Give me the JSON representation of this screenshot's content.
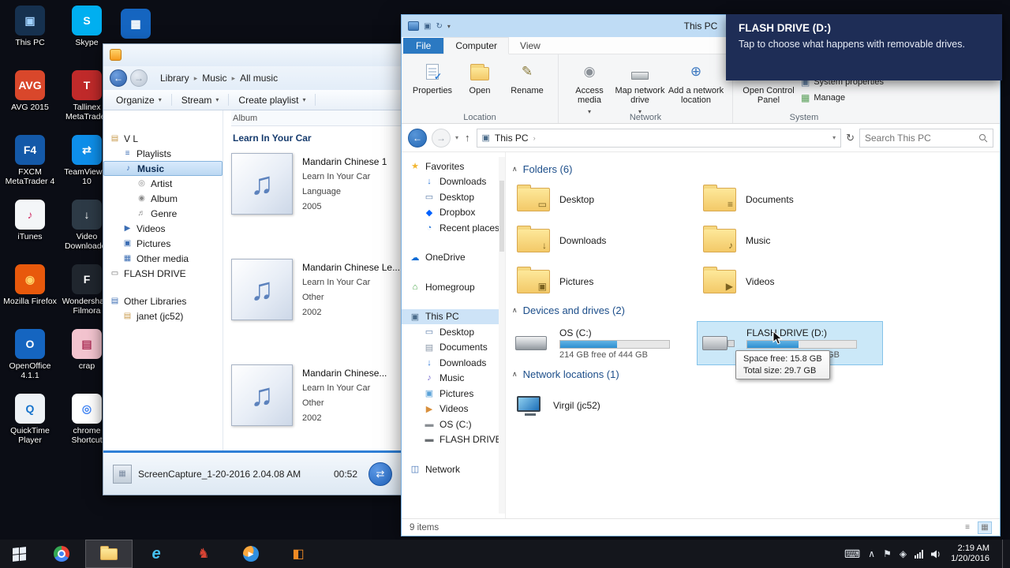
{
  "icons": {
    "back": "←",
    "forward": "→",
    "up": "↑",
    "dropdown": "▾",
    "refresh": "↻",
    "crumb_sep": "▸",
    "chevron": "›",
    "collapse": "∧",
    "album_note": "♫",
    "thumb": "▦",
    "shuffle": "⇄",
    "rename": "✎",
    "disc": "◉",
    "add_location": "⊕",
    "sysprops": "▣",
    "manage": "▦",
    "pc": "▣",
    "check": "✓",
    "keyboard": "⌨",
    "tray_chevron": "∧",
    "flag": "⚑",
    "diamond": "◈",
    "ie": "e",
    "knight": "♞",
    "appbox": "◧",
    "list_view": "≡",
    "thumb_view": "▦"
  },
  "desktop": {
    "icons": [
      {
        "label": "This PC",
        "glyph": "▣",
        "bg": "#16314f",
        "fg": "#9fd1ff"
      },
      {
        "label": "Skype",
        "glyph": "S",
        "bg": "#00aff0",
        "fg": "#ffffff"
      },
      {
        "label": "AVG 2015",
        "glyph": "AVG",
        "bg": "#d9472b",
        "fg": "#ffffff"
      },
      {
        "label": "Tallinex MetaTrader",
        "glyph": "T",
        "bg": "#c02a2a",
        "fg": "#ffffff"
      },
      {
        "label": "FXCM MetaTrader 4",
        "glyph": "F4",
        "bg": "#1459a8",
        "fg": "#ffffff"
      },
      {
        "label": "TeamViewer 10",
        "glyph": "⇄",
        "bg": "#0e8ee9",
        "fg": "#ffffff"
      },
      {
        "label": "iTunes",
        "glyph": "♪",
        "bg": "#f4f6f8",
        "fg": "#d3366b"
      },
      {
        "label": "Video Downloader",
        "glyph": "↓",
        "bg": "#2d3a46",
        "fg": "#ffffff"
      },
      {
        "label": "Mozilla Firefox",
        "glyph": "◉",
        "bg": "#e8590c",
        "fg": "#ffd166"
      },
      {
        "label": "Wondershare Filmora",
        "glyph": "F",
        "bg": "#20262e",
        "fg": "#ffffff"
      },
      {
        "label": "OpenOffice 4.1.1",
        "glyph": "O",
        "bg": "#1565c0",
        "fg": "#ffffff"
      },
      {
        "label": "crap",
        "glyph": "▤",
        "bg": "#f3c4cf",
        "fg": "#b0355c"
      },
      {
        "label": "QuickTime Player",
        "glyph": "Q",
        "bg": "#eef2f6",
        "fg": "#1673cc"
      },
      {
        "label": "chrome Shortcut",
        "glyph": "◎",
        "bg": "#ffffff",
        "fg": "#4285f4"
      }
    ],
    "floating_icon": {
      "glyph": "▦"
    }
  },
  "media_player": {
    "breadcrumb": {
      "items": [
        "Library",
        "Music",
        "All music"
      ]
    },
    "toolbar": {
      "items": [
        {
          "label": "Organize"
        },
        {
          "label": "Stream"
        },
        {
          "label": "Create playlist"
        }
      ]
    },
    "tree": {
      "items": [
        {
          "label": "V L",
          "glyph": "▤",
          "indent": 0,
          "color": "#c99b4e"
        },
        {
          "label": "Playlists",
          "glyph": "≡",
          "indent": 1,
          "color": "#3c6eb4"
        },
        {
          "label": "Music",
          "glyph": "♪",
          "indent": 1,
          "color": "#3c6eb4",
          "selected": true
        },
        {
          "label": "Artist",
          "glyph": "◎",
          "indent": 2,
          "color": "#8a8a8a"
        },
        {
          "label": "Album",
          "glyph": "◉",
          "indent": 2,
          "color": "#8a8a8a"
        },
        {
          "label": "Genre",
          "glyph": "♬",
          "indent": 2,
          "color": "#8a8a8a"
        },
        {
          "label": "Videos",
          "glyph": "▶",
          "indent": 1,
          "color": "#3c6eb4"
        },
        {
          "label": "Pictures",
          "glyph": "▣",
          "indent": 1,
          "color": "#3c6eb4"
        },
        {
          "label": "Other media",
          "glyph": "▦",
          "indent": 1,
          "color": "#3c6eb4"
        },
        {
          "label": "FLASH DRIVE",
          "glyph": "▭",
          "indent": 0,
          "color": "#6b6b6b"
        },
        {
          "label": "Other Libraries",
          "glyph": "▤",
          "indent": 0,
          "color": "#3c6eb4",
          "spacer": true
        },
        {
          "label": "janet (jc52)",
          "glyph": "▤",
          "indent": 1,
          "color": "#c99b4e"
        }
      ]
    },
    "list": {
      "column_header": "Album",
      "group_title": "Learn In Your Car",
      "items": [
        {
          "title": "Mandarin Chinese 1",
          "artist": "Learn In Your Car",
          "genre": "Language",
          "year": "2005"
        },
        {
          "title": "Mandarin Chinese Le...",
          "artist": "Learn In Your Car",
          "genre": "Other",
          "year": "2002"
        },
        {
          "title": "Mandarin Chinese...",
          "artist": "Learn In Your Car",
          "genre": "Other",
          "year": "2002"
        }
      ]
    },
    "playback": {
      "file": "ScreenCapture_1-20-2016 2.04.08 AM",
      "time": "00:52"
    }
  },
  "explorer": {
    "title": "This PC",
    "tabs": {
      "file": "File",
      "computer": "Computer",
      "view": "View"
    },
    "ribbon": {
      "properties": "Properties",
      "open": "Open",
      "rename": "Rename",
      "access_media": "Access media",
      "map_drive": "Map network drive",
      "add_location": "Add a network location",
      "control_panel": "Open Control Panel",
      "system_properties": "System properties",
      "manage": "Manage",
      "groups": {
        "location": "Location",
        "network": "Network",
        "system": "System"
      }
    },
    "address": {
      "path": "This PC",
      "search_placeholder": "Search This PC"
    },
    "nav": {
      "items": [
        {
          "label": "Favorites",
          "glyph": "★",
          "indent": 0,
          "color": "#f2b632"
        },
        {
          "label": "Downloads",
          "glyph": "↓",
          "indent": 1,
          "color": "#2f7bd9"
        },
        {
          "label": "Desktop",
          "glyph": "▭",
          "indent": 1,
          "color": "#5a7ca8"
        },
        {
          "label": "Dropbox",
          "glyph": "◆",
          "indent": 1,
          "color": "#0061fe"
        },
        {
          "label": "Recent places",
          "glyph": "◔",
          "indent": 1,
          "color": "#2f7bd9"
        },
        {
          "label": "OneDrive",
          "glyph": "☁",
          "indent": 0,
          "color": "#0a6cd6",
          "gap": true
        },
        {
          "label": "Homegroup",
          "glyph": "⌂",
          "indent": 0,
          "color": "#3fa13f",
          "gap": true
        },
        {
          "label": "This PC",
          "glyph": "▣",
          "indent": 0,
          "color": "#4a6b8a",
          "gap": true,
          "selected": true
        },
        {
          "label": "Desktop",
          "glyph": "▭",
          "indent": 1,
          "color": "#5a7ca8"
        },
        {
          "label": "Documents",
          "glyph": "▤",
          "indent": 1,
          "color": "#8a97a8"
        },
        {
          "label": "Downloads",
          "glyph": "↓",
          "indent": 1,
          "color": "#2f7bd9"
        },
        {
          "label": "Music",
          "glyph": "♪",
          "indent": 1,
          "color": "#7a6fd0"
        },
        {
          "label": "Pictures",
          "glyph": "▣",
          "indent": 1,
          "color": "#5aa2d8"
        },
        {
          "label": "Videos",
          "glyph": "▶",
          "indent": 1,
          "color": "#d88f3c"
        },
        {
          "label": "OS (C:)",
          "glyph": "▬",
          "indent": 1,
          "color": "#8a8f94"
        },
        {
          "label": "FLASH DRIVE (D",
          "glyph": "▬",
          "indent": 1,
          "color": "#6b6f73"
        },
        {
          "label": "Network",
          "glyph": "◫",
          "indent": 0,
          "color": "#3c6eb4",
          "gap": true
        }
      ]
    },
    "content": {
      "folders": {
        "header": "Folders (6)",
        "items": [
          {
            "label": "Desktop",
            "glyph": "▭"
          },
          {
            "label": "Documents",
            "glyph": "≡"
          },
          {
            "label": "Downloads",
            "glyph": "↓"
          },
          {
            "label": "Music",
            "glyph": "♪"
          },
          {
            "label": "Pictures",
            "glyph": "▣"
          },
          {
            "label": "Videos",
            "glyph": "▶"
          }
        ]
      },
      "devices": {
        "header": "Devices and drives (2)",
        "items": [
          {
            "name": "OS (C:)",
            "caption": "214 GB free of 444 GB",
            "fill": 52,
            "type": "hdd"
          },
          {
            "name": "FLASH DRIVE (D:)",
            "caption": "15.8 GB free of 29.7 GB",
            "fill": 47,
            "type": "usb",
            "selected": true
          }
        ]
      },
      "network": {
        "header": "Network locations (1)",
        "items": [
          {
            "label": "Virgil (jc52)"
          }
        ]
      }
    },
    "tooltip": {
      "line1": "Space free: 15.8 GB",
      "line2": "Total size: 29.7 GB"
    },
    "status": {
      "items_count": "9 items"
    }
  },
  "toast": {
    "title": "FLASH DRIVE (D:)",
    "body": "Tap to choose what happens with removable drives."
  },
  "taskbar": {
    "clock": {
      "time": "2:19 AM",
      "date": "1/20/2016"
    }
  }
}
